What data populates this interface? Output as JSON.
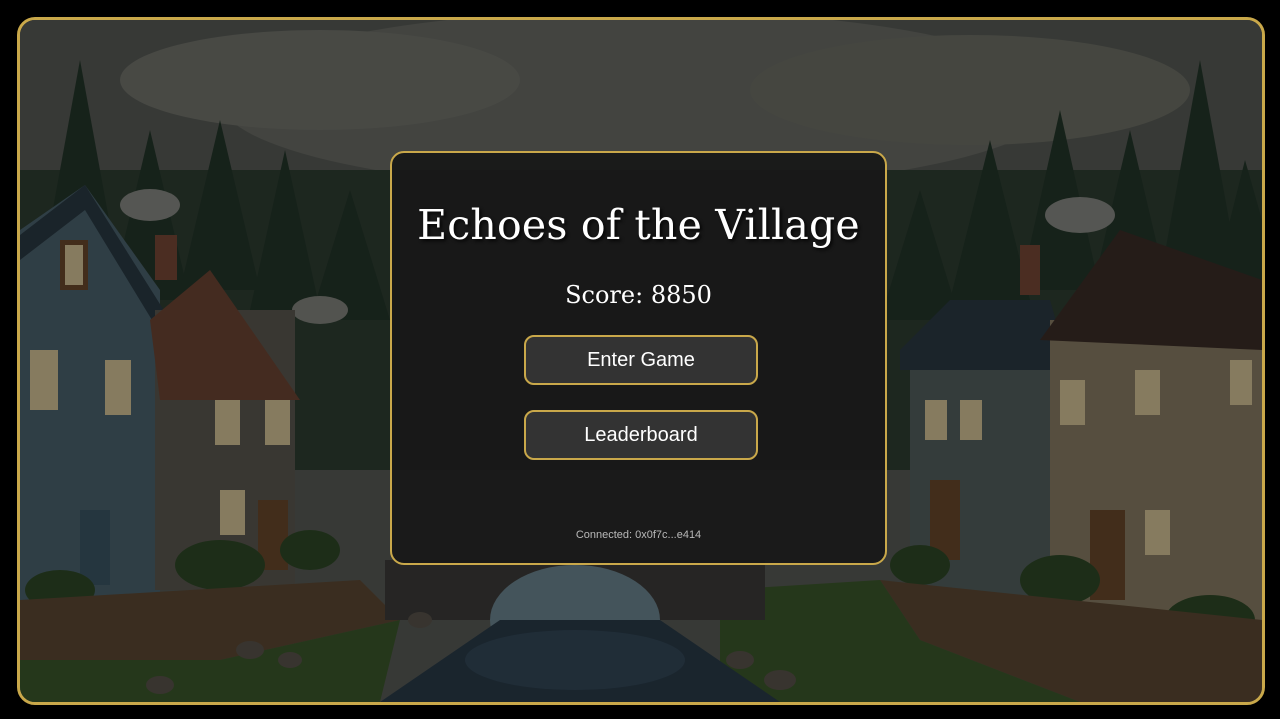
{
  "game": {
    "title": "Echoes of the Village",
    "score_text": "Score: 8850",
    "score_value": 8850
  },
  "menu": {
    "enter_label": "Enter Game",
    "leaderboard_label": "Leaderboard"
  },
  "wallet": {
    "connected_text": "Connected: 0x0f7c...e414"
  },
  "theme": {
    "accent": "#c9a84a",
    "panel_bg": "#181818",
    "button_bg": "#333333",
    "text": "#ffffff"
  },
  "background": {
    "scene": "pixel-art village with cottages, pine forest, stone bridge and stream"
  }
}
